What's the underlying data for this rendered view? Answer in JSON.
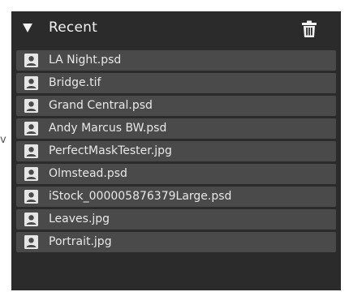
{
  "panel": {
    "title": "Recent",
    "disclosure_icon": "triangle-down-icon",
    "clear_icon": "trash-icon"
  },
  "files": [
    {
      "name": "LA Night.psd"
    },
    {
      "name": "Bridge.tif"
    },
    {
      "name": "Grand Central.psd"
    },
    {
      "name": "Andy Marcus BW.psd"
    },
    {
      "name": "PerfectMaskTester.jpg"
    },
    {
      "name": "Olmstead.psd"
    },
    {
      "name": "iStock_000005876379Large.psd"
    },
    {
      "name": "Leaves.jpg"
    },
    {
      "name": "Portrait.jpg"
    }
  ],
  "colors": {
    "panel_bg": "#2b2b2b",
    "row_bg": "#4a4a4a",
    "text": "#e8e8e8"
  }
}
